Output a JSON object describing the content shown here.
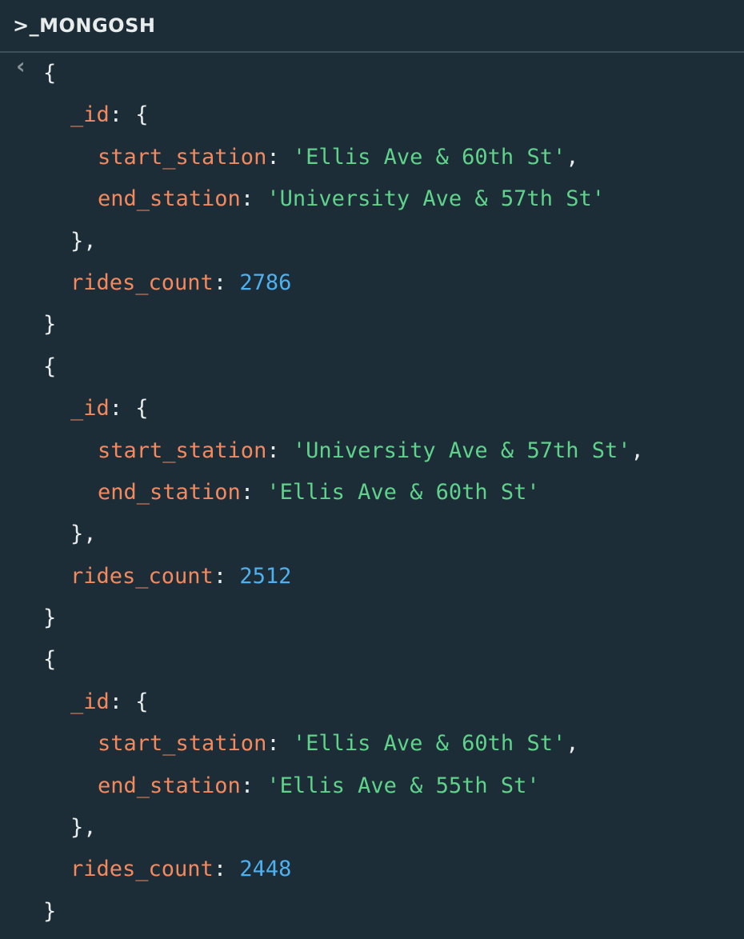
{
  "header": {
    "title": ">_MONGOSH"
  },
  "icons": {
    "result_marker": "chevron-left-icon"
  },
  "colors": {
    "background": "#1c2d38",
    "key": "#f4895e",
    "string": "#5fd38a",
    "number": "#4fb0f0",
    "text": "#e8edeb"
  },
  "results": [
    {
      "open": "{",
      "id_key": "_id",
      "id_open": "{",
      "start_key": "start_station",
      "start_value": "'Ellis Ave & 60th St'",
      "end_key": "end_station",
      "end_value": "'University Ave & 57th St'",
      "id_close": "},",
      "count_key": "rides_count",
      "count_value": "2786",
      "close": "}"
    },
    {
      "open": "{",
      "id_key": "_id",
      "id_open": "{",
      "start_key": "start_station",
      "start_value": "'University Ave & 57th St'",
      "end_key": "end_station",
      "end_value": "'Ellis Ave & 60th St'",
      "id_close": "},",
      "count_key": "rides_count",
      "count_value": "2512",
      "close": "}"
    },
    {
      "open": "{",
      "id_key": "_id",
      "id_open": "{",
      "start_key": "start_station",
      "start_value": "'Ellis Ave & 60th St'",
      "end_key": "end_station",
      "end_value": "'Ellis Ave & 55th St'",
      "id_close": "},",
      "count_key": "rides_count",
      "count_value": "2448",
      "close": "}"
    }
  ]
}
